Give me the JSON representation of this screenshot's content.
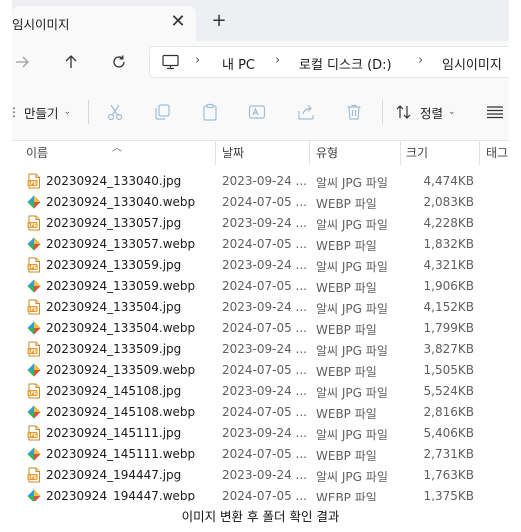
{
  "tab": {
    "title": "임시이미지",
    "close": "✕",
    "new_tab": "+"
  },
  "address": {
    "crumbs": [
      "내 PC",
      "로컬 디스크 (D:)",
      "임시이미지"
    ],
    "separator": "›"
  },
  "commands": {
    "new_label": "만들기",
    "sort_label": "정렬"
  },
  "columns": {
    "name": "이름",
    "date": "날짜",
    "type": "유형",
    "size": "크기",
    "tag": "태그"
  },
  "files": [
    {
      "name": "20230924_133040.jpg",
      "date": "2023-09-24 ...",
      "type": "알씨 JPG 파일",
      "size": "4,474KB",
      "kind": "jpg"
    },
    {
      "name": "20230924_133040.webp",
      "date": "2024-07-05 ...",
      "type": "WEBP 파일",
      "size": "2,083KB",
      "kind": "webp"
    },
    {
      "name": "20230924_133057.jpg",
      "date": "2023-09-24 ...",
      "type": "알씨 JPG 파일",
      "size": "4,228KB",
      "kind": "jpg"
    },
    {
      "name": "20230924_133057.webp",
      "date": "2024-07-05 ...",
      "type": "WEBP 파일",
      "size": "1,832KB",
      "kind": "webp"
    },
    {
      "name": "20230924_133059.jpg",
      "date": "2023-09-24 ...",
      "type": "알씨 JPG 파일",
      "size": "4,321KB",
      "kind": "jpg"
    },
    {
      "name": "20230924_133059.webp",
      "date": "2024-07-05 ...",
      "type": "WEBP 파일",
      "size": "1,906KB",
      "kind": "webp"
    },
    {
      "name": "20230924_133504.jpg",
      "date": "2023-09-24 ...",
      "type": "알씨 JPG 파일",
      "size": "4,152KB",
      "kind": "jpg"
    },
    {
      "name": "20230924_133504.webp",
      "date": "2024-07-05 ...",
      "type": "WEBP 파일",
      "size": "1,799KB",
      "kind": "webp"
    },
    {
      "name": "20230924_133509.jpg",
      "date": "2023-09-24 ...",
      "type": "알씨 JPG 파일",
      "size": "3,827KB",
      "kind": "jpg"
    },
    {
      "name": "20230924_133509.webp",
      "date": "2024-07-05 ...",
      "type": "WEBP 파일",
      "size": "1,505KB",
      "kind": "webp"
    },
    {
      "name": "20230924_145108.jpg",
      "date": "2023-09-24 ...",
      "type": "알씨 JPG 파일",
      "size": "5,524KB",
      "kind": "jpg"
    },
    {
      "name": "20230924_145108.webp",
      "date": "2024-07-05 ...",
      "type": "WEBP 파일",
      "size": "2,816KB",
      "kind": "webp"
    },
    {
      "name": "20230924_145111.jpg",
      "date": "2023-09-24 ...",
      "type": "알씨 JPG 파일",
      "size": "5,406KB",
      "kind": "jpg"
    },
    {
      "name": "20230924_145111.webp",
      "date": "2024-07-05 ...",
      "type": "WEBP 파일",
      "size": "2,731KB",
      "kind": "webp"
    },
    {
      "name": "20230924_194447.jpg",
      "date": "2023-09-24 ...",
      "type": "알씨 JPG 파일",
      "size": "1,763KB",
      "kind": "jpg"
    },
    {
      "name": "20230924_194447.webp",
      "date": "2024-07-05 ...",
      "type": "WEBP 파일",
      "size": "1,375KB",
      "kind": "webp"
    }
  ],
  "caption": "이미지 변환 후 폴더 확인 결과",
  "icons": {
    "jpg": "jpg-file-icon",
    "webp": "webp-file-icon"
  },
  "colors": {
    "chrome": "#f9f9f9",
    "tab_strip": "#eeeff2",
    "jpg_icon": "#e89a2c",
    "webp_icon": "#2f9be0",
    "disabled_icon": "#9fbfd6"
  }
}
